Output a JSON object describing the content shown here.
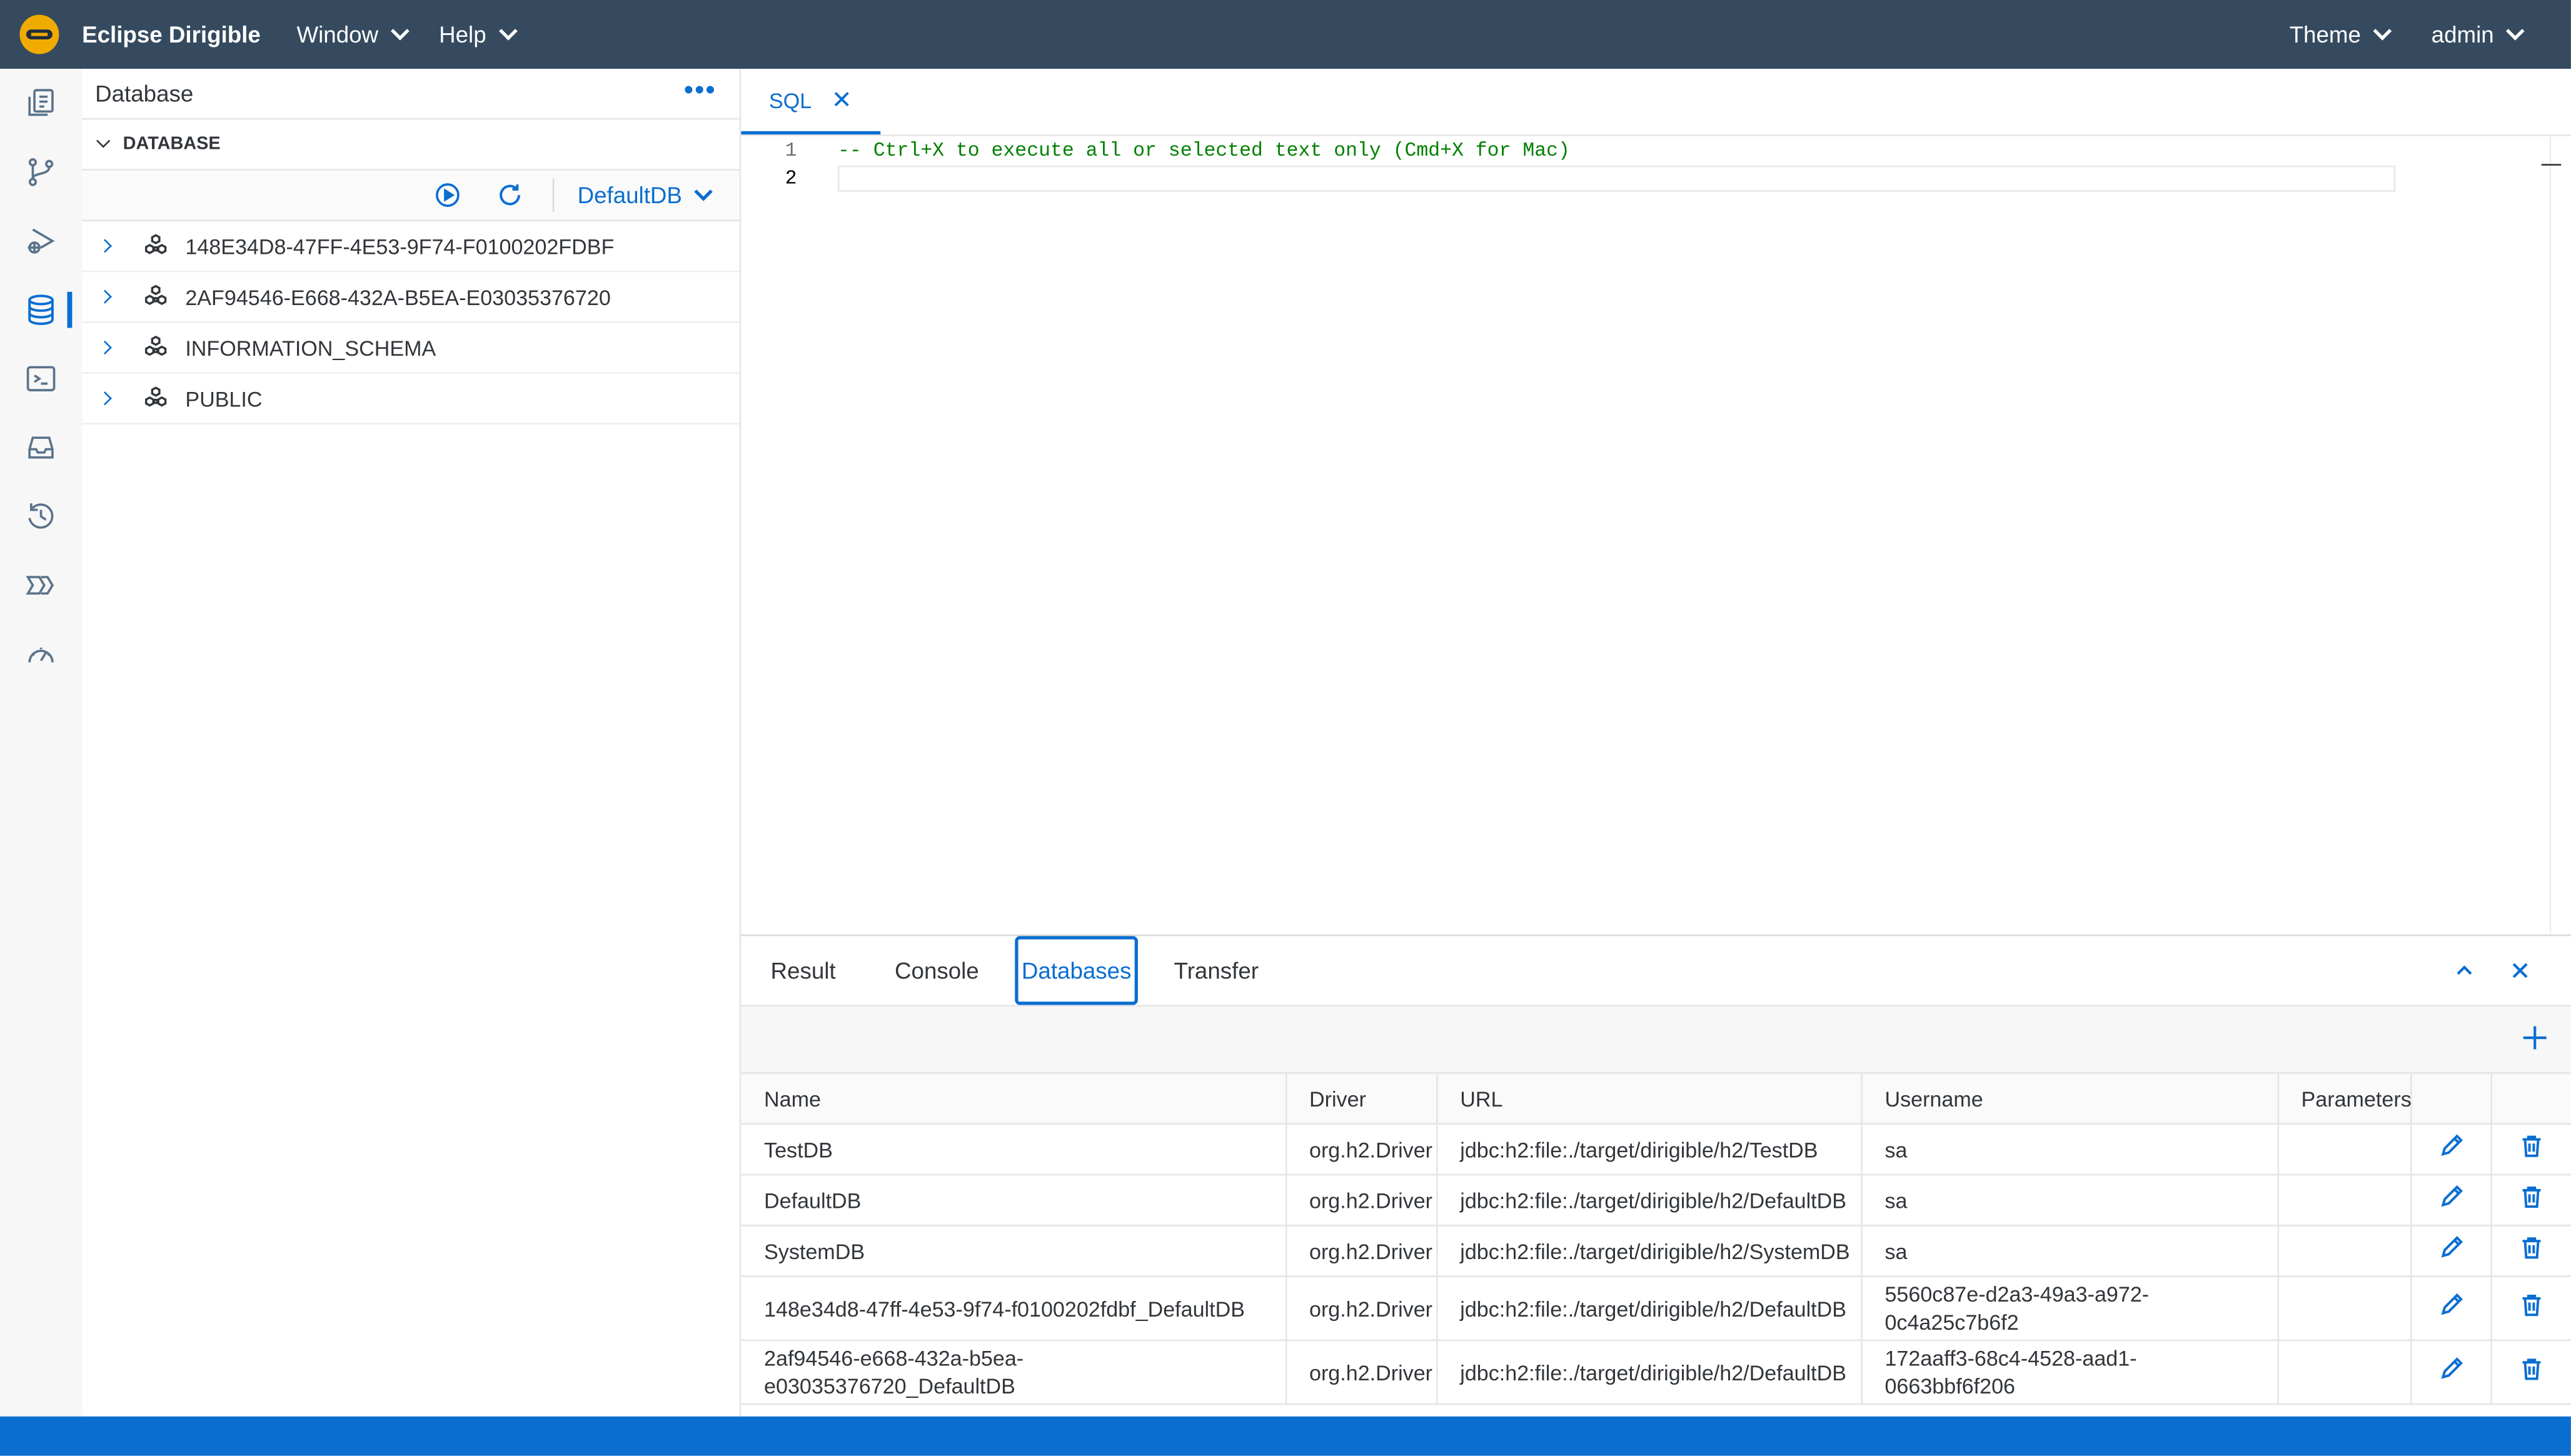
{
  "app": {
    "title": "Eclipse Dirigible"
  },
  "menus": {
    "window": "Window",
    "help": "Help",
    "theme": "Theme",
    "user": "admin"
  },
  "sidebar": {
    "title": "Database",
    "section": "DATABASE",
    "selected_db": "DefaultDB",
    "schemas": [
      "148E34D8-47FF-4E53-9F74-F0100202FDBF",
      "2AF94546-E668-432A-B5EA-E03035376720",
      "INFORMATION_SCHEMA",
      "PUBLIC"
    ]
  },
  "editor": {
    "tab": "SQL",
    "lines": [
      {
        "num": "1",
        "text": "-- Ctrl+X to execute all or selected text only (Cmd+X for Mac)"
      },
      {
        "num": "2",
        "text": ""
      }
    ]
  },
  "panel": {
    "tabs": [
      "Result",
      "Console",
      "Databases",
      "Transfer"
    ],
    "active_tab": "Databases",
    "columns": [
      "Name",
      "Driver",
      "URL",
      "Username",
      "Parameters"
    ],
    "rows": [
      {
        "name": "TestDB",
        "driver": "org.h2.Driver",
        "url": "jdbc:h2:file:./target/dirigible/h2/TestDB",
        "username": "sa",
        "parameters": ""
      },
      {
        "name": "DefaultDB",
        "driver": "org.h2.Driver",
        "url": "jdbc:h2:file:./target/dirigible/h2/DefaultDB",
        "username": "sa",
        "parameters": ""
      },
      {
        "name": "SystemDB",
        "driver": "org.h2.Driver",
        "url": "jdbc:h2:file:./target/dirigible/h2/SystemDB",
        "username": "sa",
        "parameters": ""
      },
      {
        "name": "148e34d8-47ff-4e53-9f74-f0100202fdbf_DefaultDB",
        "driver": "org.h2.Driver",
        "url": "jdbc:h2:file:./target/dirigible/h2/DefaultDB",
        "username": "5560c87e-d2a3-49a3-a972-0c4a25c7b6f2",
        "parameters": ""
      },
      {
        "name": "2af94546-e668-432a-b5ea-e03035376720_DefaultDB",
        "driver": "org.h2.Driver",
        "url": "jdbc:h2:file:./target/dirigible/h2/DefaultDB",
        "username": "172aaff3-68c4-4528-aad1-0663bbf6f206",
        "parameters": ""
      }
    ]
  },
  "colors": {
    "shell": "#354a5f",
    "accent": "#0a6ed1",
    "logo": "#f0ab00",
    "comment": "#008000"
  },
  "icons": {
    "activity": [
      "explorer-icon",
      "git-branch-icon",
      "debug-icon",
      "database-icon",
      "terminal-icon",
      "inbox-icon",
      "history-icon",
      "operations-icon",
      "dashboard-icon"
    ]
  }
}
